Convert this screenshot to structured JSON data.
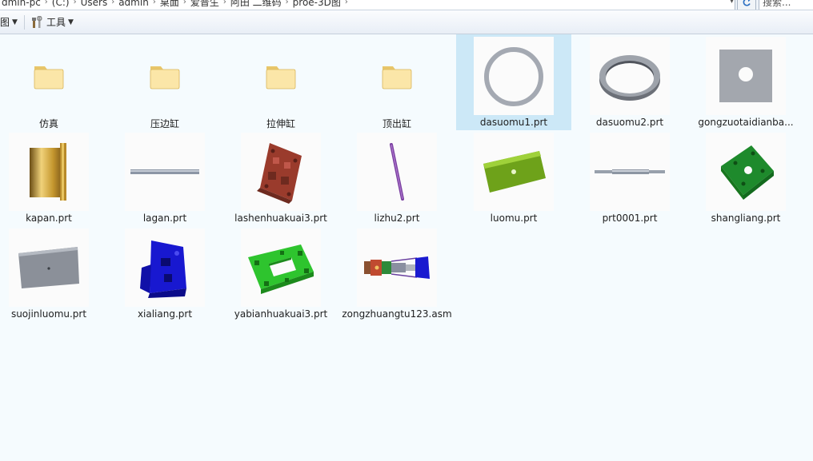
{
  "address": {
    "crumbs": [
      "dmin-pc",
      "(C:)",
      "Users",
      "admin",
      "桌面",
      "爱普生",
      "阿田 二维码",
      "proe-3D图"
    ]
  },
  "search": {
    "placeholder": "搜索..."
  },
  "toolbar": {
    "view_label": "图",
    "tools_label": "工具"
  },
  "items": [
    {
      "name": "仿真",
      "type": "folder"
    },
    {
      "name": "压边缸",
      "type": "folder"
    },
    {
      "name": "拉伸缸",
      "type": "folder"
    },
    {
      "name": "顶出缸",
      "type": "folder"
    },
    {
      "name": "dasuomu1.prt",
      "type": "ring-thin",
      "selected": true
    },
    {
      "name": "dasuomu2.prt",
      "type": "ring-3d"
    },
    {
      "name": "gongzuotaidianba...",
      "type": "plate-hole"
    },
    {
      "name": "kapan.prt",
      "type": "bushing"
    },
    {
      "name": "lagan.prt",
      "type": "rod-h"
    },
    {
      "name": "lashenhuakuai3.prt",
      "type": "block-red"
    },
    {
      "name": "lizhu2.prt",
      "type": "rod-diag"
    },
    {
      "name": "luomu.prt",
      "type": "plate-green"
    },
    {
      "name": "prt0001.prt",
      "type": "rod-h2"
    },
    {
      "name": "shangliang.prt",
      "type": "block-green"
    },
    {
      "name": "suojinluomu.prt",
      "type": "plate-gray"
    },
    {
      "name": "xialiang.prt",
      "type": "block-blue"
    },
    {
      "name": "yabianhuakuai3.prt",
      "type": "frame-green"
    },
    {
      "name": "zongzhuangtu123.asm",
      "type": "assembly"
    }
  ]
}
